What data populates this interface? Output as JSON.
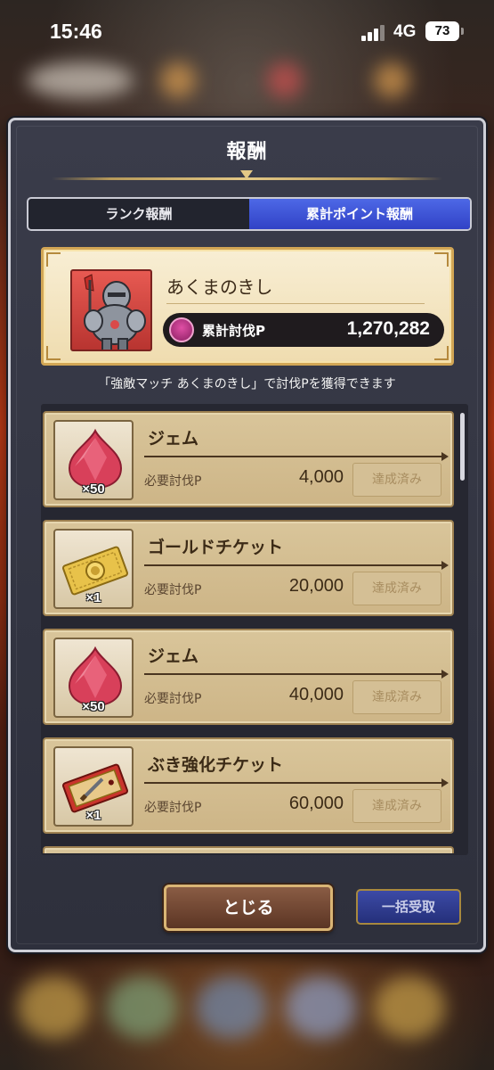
{
  "status_bar": {
    "time": "15:46",
    "network": "4G",
    "battery": "73"
  },
  "dialog": {
    "title": "報酬",
    "tabs": [
      {
        "label": "ランク報酬",
        "active": false
      },
      {
        "label": "累計ポイント報酬",
        "active": true
      }
    ],
    "boss": {
      "name": "あくまのきし",
      "points_label": "累計討伐P",
      "points_value": "1,270,282"
    },
    "notice": "「強敵マッチ あくまのきし」で討伐Pを獲得できます",
    "rewards": [
      {
        "name": "ジェム",
        "quantity": "×50",
        "icon": "gem-icon",
        "requirement_label": "必要討伐P",
        "requirement_value": "4,000",
        "status": "達成済み"
      },
      {
        "name": "ゴールドチケット",
        "quantity": "×1",
        "icon": "gold-ticket-icon",
        "requirement_label": "必要討伐P",
        "requirement_value": "20,000",
        "status": "達成済み"
      },
      {
        "name": "ジェム",
        "quantity": "×50",
        "icon": "gem-icon",
        "requirement_label": "必要討伐P",
        "requirement_value": "40,000",
        "status": "達成済み"
      },
      {
        "name": "ぶき強化チケット",
        "quantity": "×1",
        "icon": "weapon-upgrade-ticket-icon",
        "requirement_label": "必要討伐P",
        "requirement_value": "60,000",
        "status": "達成済み"
      }
    ],
    "close_label": "とじる",
    "bulk_receive_label": "一括受取"
  },
  "colors": {
    "tab_active": "#3f56d6",
    "card_bg": "#f3e6c3",
    "item_bg": "#d3bd90",
    "close_button": "#6e4432",
    "bulk_button": "#2f3a8e"
  }
}
